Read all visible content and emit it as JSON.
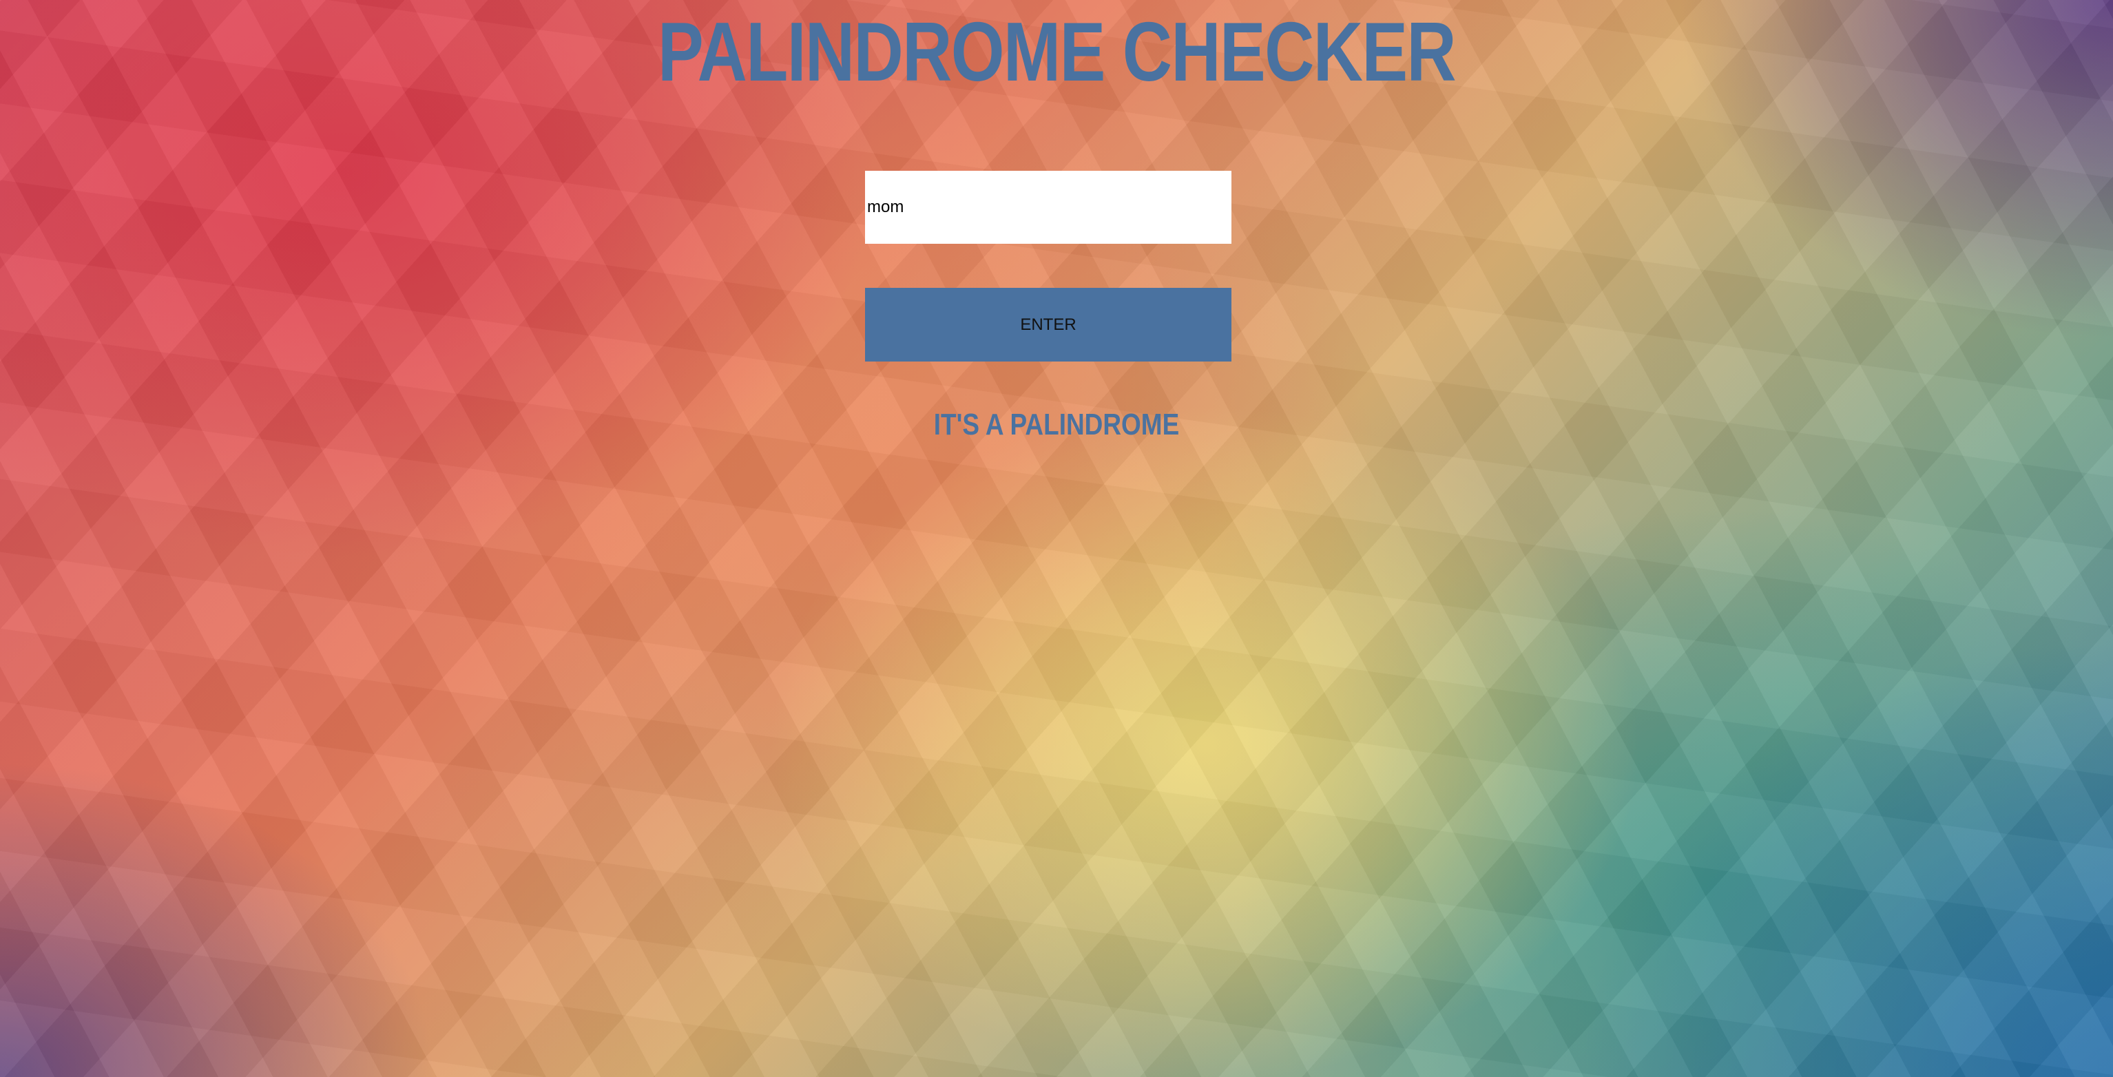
{
  "page": {
    "title": "PALINDROME CHECKER"
  },
  "form": {
    "input_value": "mom",
    "button_label": "ENTER"
  },
  "result": {
    "text": "IT'S A PALINDROME"
  },
  "colors": {
    "accent": "#4a72a0",
    "input_background": "#ffffff"
  }
}
